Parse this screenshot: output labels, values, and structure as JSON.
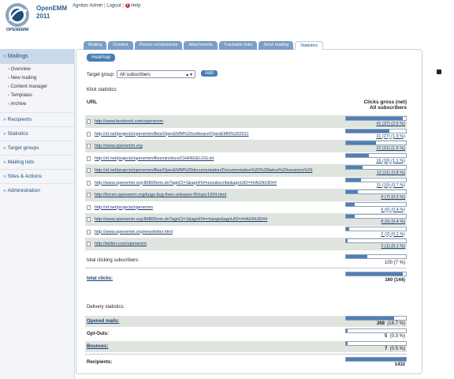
{
  "app": {
    "name": "OpenEMM",
    "version": "2011",
    "logo_text": "OPENEMM"
  },
  "topbar": {
    "user": "Agnitas Admin",
    "logout": "Logout",
    "help": "Help"
  },
  "sidebar": {
    "active": "Mailings",
    "subitems": [
      "Overview",
      "New mailing",
      "Content manager",
      "Templates",
      "Archive"
    ],
    "items": [
      "Recipients",
      "Statistics",
      "Target groups",
      "Mailing lists",
      "Sites & Actions",
      "Administration"
    ]
  },
  "tabs": [
    "Mailing",
    "Content",
    "Picture components",
    "Attachments",
    "Trackable links",
    "Send mailing",
    "Statistics"
  ],
  "heatmap_button": "Heatmap",
  "target_group": {
    "label": "Target group:",
    "value": "All subscribers",
    "add_label": "Add"
  },
  "klick_statistics_label": "Klick statistics:",
  "table": {
    "url_header": "URL",
    "clicks_header_line1": "Clicks gross (net)",
    "clicks_header_line2": "All subscribers",
    "rows": [
      {
        "url": "http://www.facebook.com/openemm",
        "value": "41 (37)  (2.6 %)",
        "fraction": 0.95
      },
      {
        "url": "http://sf.net/projects/openemm/files/OpenEMM%20software/OpenEMM%202011",
        "value": "31 (27)  (1.9 %)",
        "fraction": 0.72
      },
      {
        "url": "http://www.openemm.org",
        "value": "22 (21)  (1.5 %)",
        "fraction": 0.5
      },
      {
        "url": "http://sf.net/projects/openemm/filesmin/docs/CHANGELOG.txt",
        "value": "16 (16)  (1.1 %)",
        "fraction": 0.38
      },
      {
        "url": "http://sf.net/projects/openemm/files/OpenEMM%20documentation/Documentation%20%28latest%20versions%29",
        "value": "12 (11)  (0.8 %)",
        "fraction": 0.28
      },
      {
        "url": "http://www.openemm.org:8080/form.do?agnCI=1&agnFN=unsubscribe&agnUID=##AGNUID##",
        "value": "11 (10)  (0.7 %)",
        "fraction": 0.25
      },
      {
        "url": "http://forum.openemm.org/bugs-bug-fixes-releases-f5/topic1934.html",
        "value": "9 (7)  (0.5 %)",
        "fraction": 0.2
      },
      {
        "url": "http://sf.net/projects/openemm",
        "value": "6 (6)  (0.4 %)",
        "fraction": 0.14
      },
      {
        "url": "http://www.openemm.org:8080/form.do?agnCI=1&agnFN=change&agnUID=##AGNUID##",
        "value": "8 (6)  (0.4 %)",
        "fraction": 0.14
      },
      {
        "url": "http://www.openemm.org/newsletter.html",
        "value": "2 (2)  (0.1 %)",
        "fraction": 0.05
      },
      {
        "url": "http://twitter.com/openemm",
        "value": "2 (1)  (0.1 %)",
        "fraction": 0.03
      }
    ],
    "total_clicking_label": "total clicking subscribers:",
    "total_clicking_value": "100  (7 %)",
    "total_clicking_fraction": 0.35,
    "total_clicks_label": "total clicks:",
    "total_clicks_value": "160 (144)",
    "total_clicks_fraction": 0.95
  },
  "delivery": {
    "label": "Delivery statistics:",
    "rows": [
      {
        "label": "Opened mails:",
        "value_bold": "268",
        "value_rest": "(18.7 %)",
        "fraction": 0.8,
        "link": true
      },
      {
        "label": "Opt-Outs:",
        "value_bold": "5",
        "value_rest": "(0.3 %)",
        "fraction": 0.02,
        "link": false
      },
      {
        "label": "Bounces:",
        "value_bold": "7",
        "value_rest": "(0.5 %)",
        "fraction": 0.02,
        "link": true
      }
    ],
    "recipients_label": "Recipients:",
    "recipients_value": "1432",
    "recipients_fraction": 1.0
  },
  "colors": {
    "bar": "#4f7fb6",
    "accent": "#1e4d7a",
    "row_shade": "#dfe4de"
  }
}
